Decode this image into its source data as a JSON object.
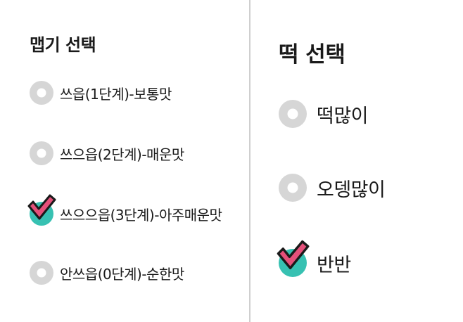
{
  "spicy": {
    "title": "맵기 선택",
    "options": [
      {
        "label": "쓰읍(1단계)-보통맛",
        "checked": false
      },
      {
        "label": "쓰으읍(2단계)-매운맛",
        "checked": false
      },
      {
        "label": "쓰으으읍(3단계)-아주매운맛",
        "checked": true
      },
      {
        "label": "안쓰읍(0단계)-순한맛",
        "checked": false
      }
    ]
  },
  "rice_cake": {
    "title": "떡 선택",
    "options": [
      {
        "label": "떡많이",
        "checked": false
      },
      {
        "label": "오뎅많이",
        "checked": false
      },
      {
        "label": "반반",
        "checked": true
      }
    ]
  },
  "colors": {
    "radio_unchecked": "#d6d6d6",
    "radio_checked": "#37c1b2",
    "checkmark_fill": "#e4507a",
    "checkmark_outline": "#1a1a1a",
    "divider": "#cfcfcf"
  }
}
